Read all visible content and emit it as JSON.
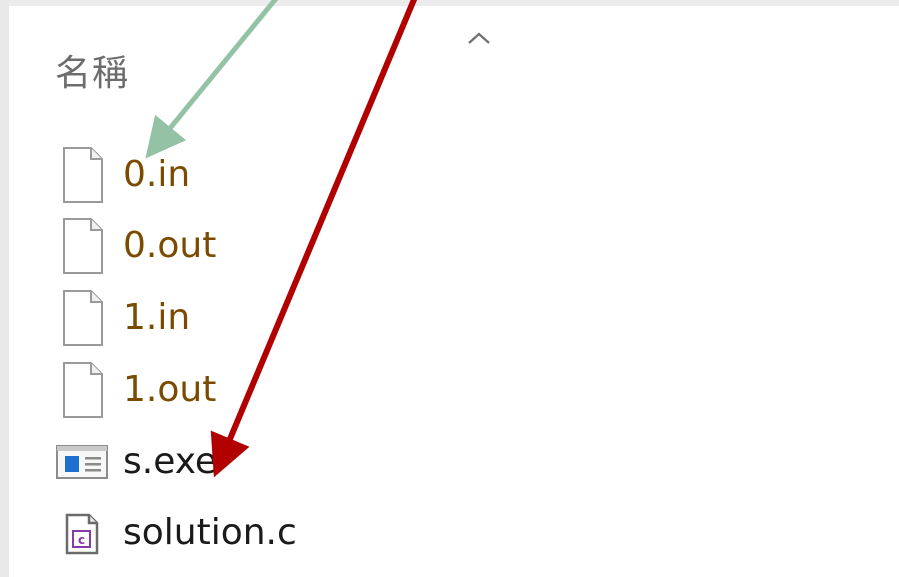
{
  "column_header": {
    "name_label": "名稱"
  },
  "files": [
    {
      "name": "0.in",
      "icon": "generic-file-icon"
    },
    {
      "name": "0.out",
      "icon": "generic-file-icon"
    },
    {
      "name": "1.in",
      "icon": "generic-file-icon"
    },
    {
      "name": "1.out",
      "icon": "generic-file-icon"
    },
    {
      "name": "s.exe",
      "icon": "application-exe-icon"
    },
    {
      "name": "solution.c",
      "icon": "c-source-file-icon"
    }
  ],
  "annotations": {
    "green_arrow_color": "#93c2a4",
    "red_arrow_color": "#b20000"
  }
}
